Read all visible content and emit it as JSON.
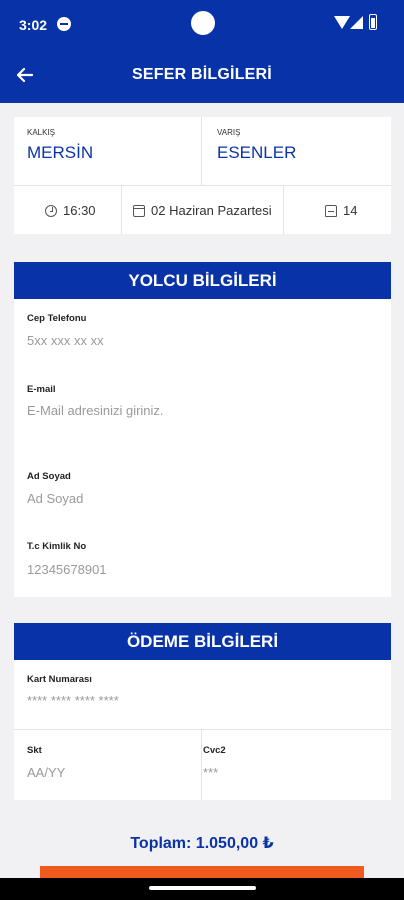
{
  "status_bar": {
    "time": "3:02"
  },
  "header": {
    "title": "SEFER BİLGİLERİ",
    "back_icon": "arrow-left-icon"
  },
  "trip": {
    "departure_label": "KALKIŞ",
    "departure_city": "MERSİN",
    "arrival_label": "VARIŞ",
    "arrival_city": "ESENLER",
    "time": "16:30",
    "date": "02 Haziran Pazartesi",
    "seat": "14"
  },
  "passenger": {
    "section_title": "YOLCU BİLGİLERİ",
    "phone_label": "Cep Telefonu",
    "phone_placeholder": "5xx xxx xx xx",
    "email_label": "E-mail",
    "email_placeholder": "E-Mail adresinizi giriniz.",
    "name_label": "Ad Soyad",
    "name_placeholder": "Ad Soyad",
    "tc_label": "T.c Kimlik No",
    "tc_placeholder": "12345678901"
  },
  "payment": {
    "section_title": "ÖDEME BİLGİLERİ",
    "card_label": "Kart Numarası",
    "card_placeholder": "**** **** **** ****",
    "expiry_label": "Skt",
    "expiry_placeholder": "AA/YY",
    "cvc_label": "Cvc2",
    "cvc_placeholder": "***"
  },
  "summary": {
    "total": "Toplam: 1.050,00 ₺"
  },
  "colors": {
    "primary": "#0833a8",
    "accent": "#f15a1e",
    "background": "#f1f1f3"
  }
}
